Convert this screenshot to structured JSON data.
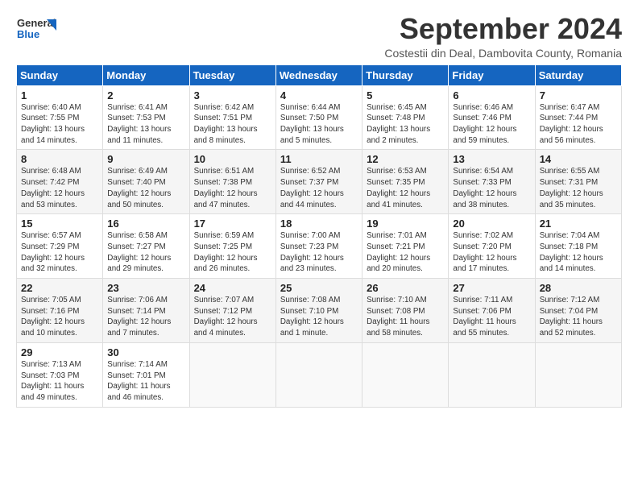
{
  "header": {
    "logo_general": "General",
    "logo_blue": "Blue",
    "month": "September 2024",
    "location": "Costestii din Deal, Dambovita County, Romania"
  },
  "days_of_week": [
    "Sunday",
    "Monday",
    "Tuesday",
    "Wednesday",
    "Thursday",
    "Friday",
    "Saturday"
  ],
  "weeks": [
    [
      {
        "day": "1",
        "sunrise": "Sunrise: 6:40 AM",
        "sunset": "Sunset: 7:55 PM",
        "daylight": "Daylight: 13 hours and 14 minutes."
      },
      {
        "day": "2",
        "sunrise": "Sunrise: 6:41 AM",
        "sunset": "Sunset: 7:53 PM",
        "daylight": "Daylight: 13 hours and 11 minutes."
      },
      {
        "day": "3",
        "sunrise": "Sunrise: 6:42 AM",
        "sunset": "Sunset: 7:51 PM",
        "daylight": "Daylight: 13 hours and 8 minutes."
      },
      {
        "day": "4",
        "sunrise": "Sunrise: 6:44 AM",
        "sunset": "Sunset: 7:50 PM",
        "daylight": "Daylight: 13 hours and 5 minutes."
      },
      {
        "day": "5",
        "sunrise": "Sunrise: 6:45 AM",
        "sunset": "Sunset: 7:48 PM",
        "daylight": "Daylight: 13 hours and 2 minutes."
      },
      {
        "day": "6",
        "sunrise": "Sunrise: 6:46 AM",
        "sunset": "Sunset: 7:46 PM",
        "daylight": "Daylight: 12 hours and 59 minutes."
      },
      {
        "day": "7",
        "sunrise": "Sunrise: 6:47 AM",
        "sunset": "Sunset: 7:44 PM",
        "daylight": "Daylight: 12 hours and 56 minutes."
      }
    ],
    [
      {
        "day": "8",
        "sunrise": "Sunrise: 6:48 AM",
        "sunset": "Sunset: 7:42 PM",
        "daylight": "Daylight: 12 hours and 53 minutes."
      },
      {
        "day": "9",
        "sunrise": "Sunrise: 6:49 AM",
        "sunset": "Sunset: 7:40 PM",
        "daylight": "Daylight: 12 hours and 50 minutes."
      },
      {
        "day": "10",
        "sunrise": "Sunrise: 6:51 AM",
        "sunset": "Sunset: 7:38 PM",
        "daylight": "Daylight: 12 hours and 47 minutes."
      },
      {
        "day": "11",
        "sunrise": "Sunrise: 6:52 AM",
        "sunset": "Sunset: 7:37 PM",
        "daylight": "Daylight: 12 hours and 44 minutes."
      },
      {
        "day": "12",
        "sunrise": "Sunrise: 6:53 AM",
        "sunset": "Sunset: 7:35 PM",
        "daylight": "Daylight: 12 hours and 41 minutes."
      },
      {
        "day": "13",
        "sunrise": "Sunrise: 6:54 AM",
        "sunset": "Sunset: 7:33 PM",
        "daylight": "Daylight: 12 hours and 38 minutes."
      },
      {
        "day": "14",
        "sunrise": "Sunrise: 6:55 AM",
        "sunset": "Sunset: 7:31 PM",
        "daylight": "Daylight: 12 hours and 35 minutes."
      }
    ],
    [
      {
        "day": "15",
        "sunrise": "Sunrise: 6:57 AM",
        "sunset": "Sunset: 7:29 PM",
        "daylight": "Daylight: 12 hours and 32 minutes."
      },
      {
        "day": "16",
        "sunrise": "Sunrise: 6:58 AM",
        "sunset": "Sunset: 7:27 PM",
        "daylight": "Daylight: 12 hours and 29 minutes."
      },
      {
        "day": "17",
        "sunrise": "Sunrise: 6:59 AM",
        "sunset": "Sunset: 7:25 PM",
        "daylight": "Daylight: 12 hours and 26 minutes."
      },
      {
        "day": "18",
        "sunrise": "Sunrise: 7:00 AM",
        "sunset": "Sunset: 7:23 PM",
        "daylight": "Daylight: 12 hours and 23 minutes."
      },
      {
        "day": "19",
        "sunrise": "Sunrise: 7:01 AM",
        "sunset": "Sunset: 7:21 PM",
        "daylight": "Daylight: 12 hours and 20 minutes."
      },
      {
        "day": "20",
        "sunrise": "Sunrise: 7:02 AM",
        "sunset": "Sunset: 7:20 PM",
        "daylight": "Daylight: 12 hours and 17 minutes."
      },
      {
        "day": "21",
        "sunrise": "Sunrise: 7:04 AM",
        "sunset": "Sunset: 7:18 PM",
        "daylight": "Daylight: 12 hours and 14 minutes."
      }
    ],
    [
      {
        "day": "22",
        "sunrise": "Sunrise: 7:05 AM",
        "sunset": "Sunset: 7:16 PM",
        "daylight": "Daylight: 12 hours and 10 minutes."
      },
      {
        "day": "23",
        "sunrise": "Sunrise: 7:06 AM",
        "sunset": "Sunset: 7:14 PM",
        "daylight": "Daylight: 12 hours and 7 minutes."
      },
      {
        "day": "24",
        "sunrise": "Sunrise: 7:07 AM",
        "sunset": "Sunset: 7:12 PM",
        "daylight": "Daylight: 12 hours and 4 minutes."
      },
      {
        "day": "25",
        "sunrise": "Sunrise: 7:08 AM",
        "sunset": "Sunset: 7:10 PM",
        "daylight": "Daylight: 12 hours and 1 minute."
      },
      {
        "day": "26",
        "sunrise": "Sunrise: 7:10 AM",
        "sunset": "Sunset: 7:08 PM",
        "daylight": "Daylight: 11 hours and 58 minutes."
      },
      {
        "day": "27",
        "sunrise": "Sunrise: 7:11 AM",
        "sunset": "Sunset: 7:06 PM",
        "daylight": "Daylight: 11 hours and 55 minutes."
      },
      {
        "day": "28",
        "sunrise": "Sunrise: 7:12 AM",
        "sunset": "Sunset: 7:04 PM",
        "daylight": "Daylight: 11 hours and 52 minutes."
      }
    ],
    [
      {
        "day": "29",
        "sunrise": "Sunrise: 7:13 AM",
        "sunset": "Sunset: 7:03 PM",
        "daylight": "Daylight: 11 hours and 49 minutes."
      },
      {
        "day": "30",
        "sunrise": "Sunrise: 7:14 AM",
        "sunset": "Sunset: 7:01 PM",
        "daylight": "Daylight: 11 hours and 46 minutes."
      },
      null,
      null,
      null,
      null,
      null
    ]
  ]
}
